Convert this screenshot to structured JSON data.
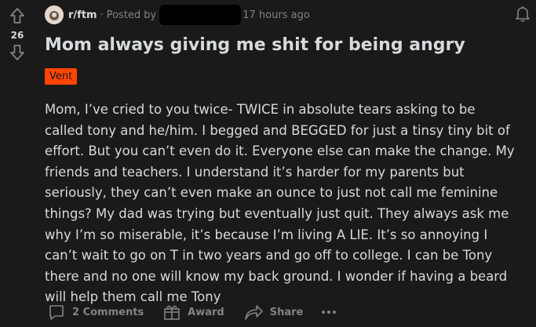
{
  "vote": {
    "count": "26"
  },
  "meta": {
    "subreddit": "r/ftm",
    "separator": "·",
    "posted_by_label": "Posted by",
    "time_ago": "17 hours ago"
  },
  "post": {
    "title": "Mom always giving me shit for being angry",
    "flair": "Vent",
    "flair_color": "#ff4500",
    "body": "Mom, I’ve cried to you twice- TWICE in absolute tears asking to be called tony and he/him. I begged and BEGGED for just a tinsy tiny bit of effort. But you can’t even do it. Everyone else can make the change. My friends and teachers. I understand it’s harder for my parents but seriously, they can’t even make an ounce to just not call me feminine things? My dad was trying but eventually just quit. They always ask me why I’m so miserable, it’s because I’m living A LIE. It’s so annoying I can’t wait to go on T in two years and go off to college. I can be Tony there and no one will know my back ground. I wonder if having a beard will help them call me Tony"
  },
  "actions": {
    "comments_label": "2 Comments",
    "award_label": "Award",
    "share_label": "Share"
  },
  "colors": {
    "background": "#1a1a1b",
    "text": "#d7dadc",
    "muted": "#818384"
  },
  "icons": [
    "upvote-icon",
    "downvote-icon",
    "subreddit-avatar-icon",
    "notification-bell-icon",
    "comment-icon",
    "award-icon",
    "share-icon",
    "more-options-icon"
  ]
}
